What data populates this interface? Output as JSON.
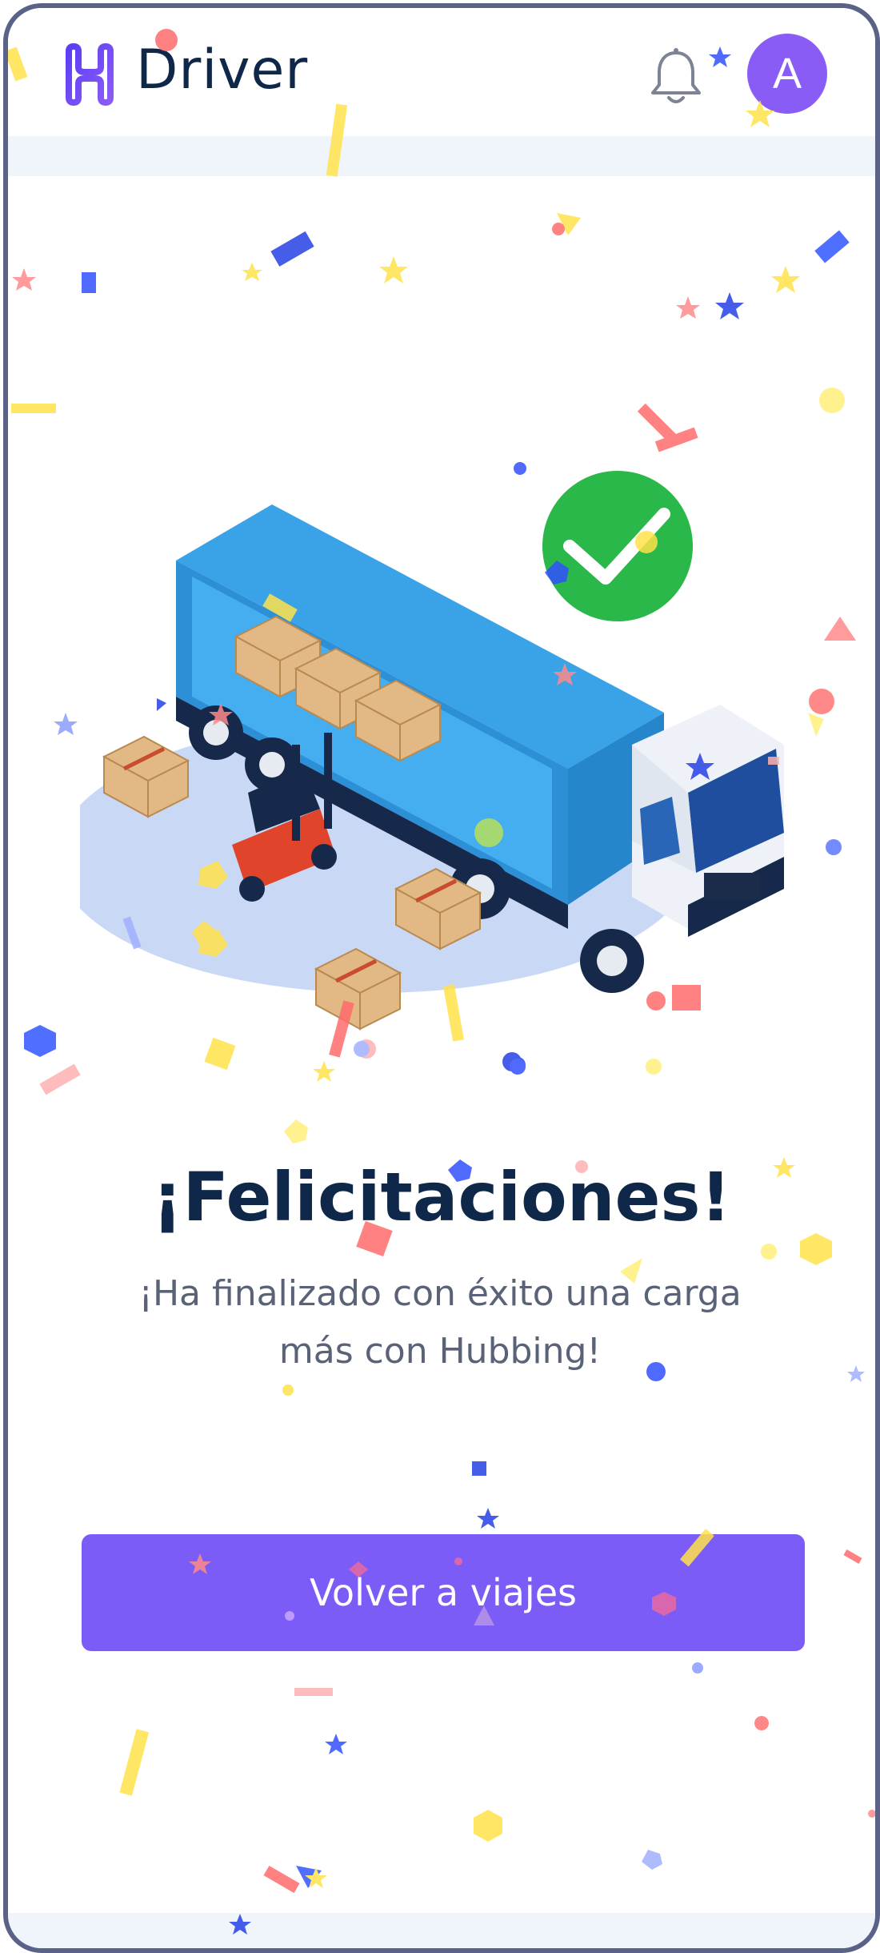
{
  "header": {
    "brand": "Driver",
    "avatar_initial": "A"
  },
  "main": {
    "title": "¡Felicitaciones!",
    "subtitle": "¡Ha finalizado con éxito una carga más con Hubbing!",
    "button_label": "Volver a viajes"
  },
  "colors": {
    "accent": "#7c5cf6",
    "avatar": "#8a5cf6",
    "success": "#2bb84a",
    "text_dark": "#0f2748",
    "text_muted": "#5a6277"
  },
  "icons": [
    "hubbing-logo-icon",
    "bell-icon",
    "check-circle-icon"
  ]
}
